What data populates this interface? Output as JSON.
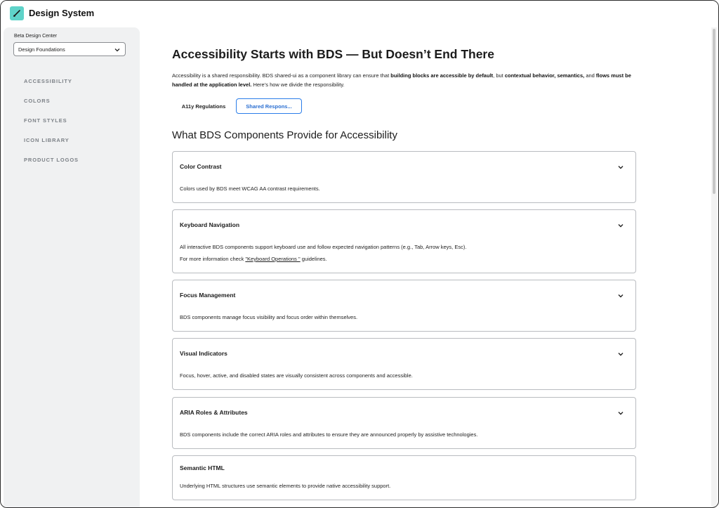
{
  "app": {
    "title": "Design System"
  },
  "sidebar": {
    "label": "Beta Design Center",
    "select_value": "Design Foundations",
    "items": [
      {
        "label": "ACCESSIBILITY"
      },
      {
        "label": "COLORS"
      },
      {
        "label": "FONT STYLES"
      },
      {
        "label": "ICON LIBRARY"
      },
      {
        "label": "PRODUCT LOGOS"
      }
    ]
  },
  "main": {
    "title": "Accessibility Starts with BDS — But Doesn’t End There",
    "intro": {
      "p1": "Accessibility is a shared responsibility. BDS shared-ui as a component library can ensure that ",
      "b1": "building blocks are accessible by default",
      "p2": ", but ",
      "b2": "contextual behavior, semantics,",
      "p3": " and ",
      "b3": "flows must be handled at the application level.",
      "p4": " Here’s how we divide the responsibility."
    },
    "tabs": [
      {
        "label": "A11y Regulations"
      },
      {
        "label": "Shared Respons..."
      }
    ],
    "section_title": "What BDS Components Provide for Accessibility",
    "cards": [
      {
        "title": "Color Contrast",
        "line1": "Colors used by BDS meet WCAG AA contrast requirements."
      },
      {
        "title": "Keyboard Navigation",
        "line1": "All interactive BDS components support keyboard use and follow expected navigation patterns (e.g., Tab, Arrow keys, Esc).",
        "line2_pre": "For more information check ",
        "line2_link": "\"Keyboard Operations \"",
        "line2_post": " guidelines."
      },
      {
        "title": "Focus Management",
        "line1": "BDS components manage focus visibility and focus order within themselves."
      },
      {
        "title": "Visual Indicators",
        "line1": "Focus, hover, active, and disabled states are visually consistent across components and accessible."
      },
      {
        "title": "ARIA Roles & Attributes",
        "line1": "BDS components include the correct ARIA roles and attributes to ensure they are announced properly by assistive technologies."
      },
      {
        "title": "Semantic HTML",
        "line1": "Underlying HTML structures use semantic elements to provide native accessibility support."
      }
    ]
  },
  "colors": {
    "accent": "#2b7de9",
    "logo": "#5fd3c9",
    "sidebar_bg": "#f0f1f2"
  }
}
